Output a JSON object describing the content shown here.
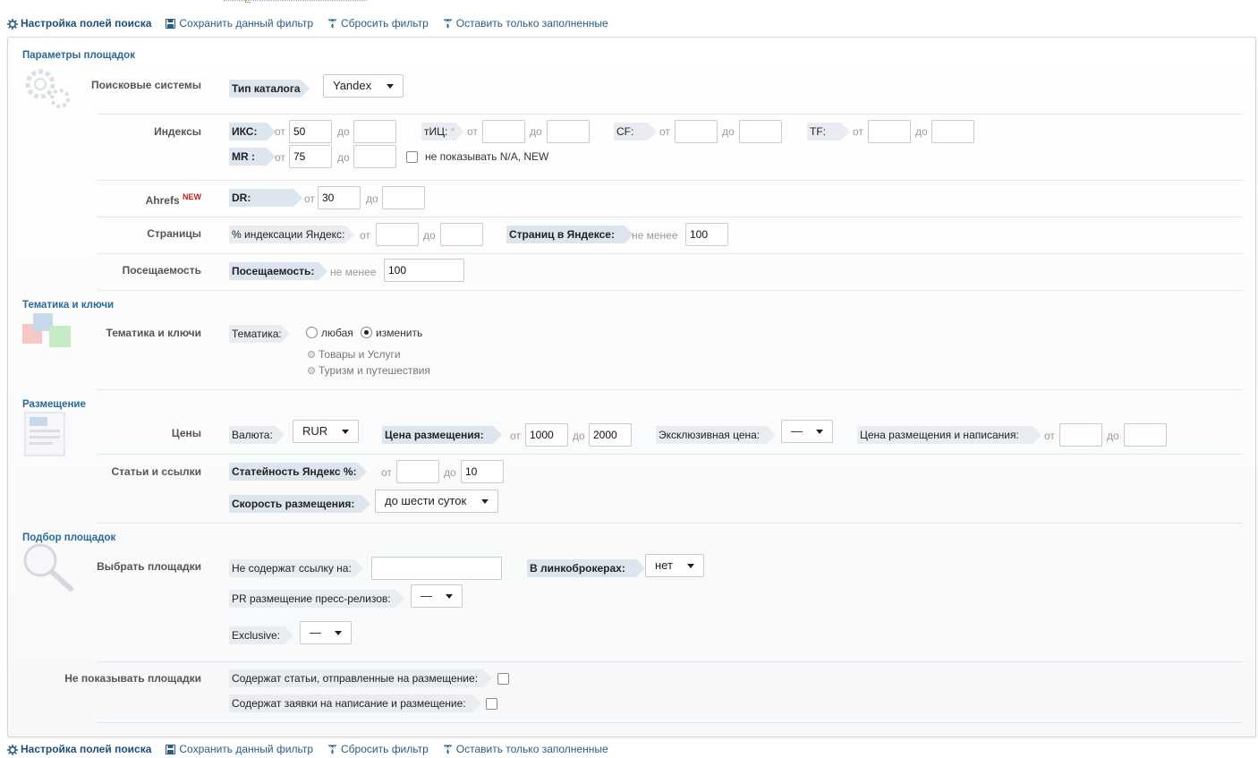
{
  "toolbar": {
    "settings": "Настройка полей поиска",
    "save": "Сохранить данный фильтр",
    "reset": "Сбросить фильтр",
    "only_filled": "Оставить только заполненные"
  },
  "sections": {
    "params": "Параметры площадок",
    "topics": "Тематика и ключи",
    "placement": "Размещение",
    "selection": "Подбор площадок"
  },
  "rows": {
    "search_engines": "Поисковые системы",
    "indexes": "Индексы",
    "ahrefs": "Ahrefs",
    "ahrefs_badge": "NEW",
    "pages": "Страницы",
    "traffic": "Посещаемость",
    "topics": "Тематика и ключи",
    "prices": "Цены",
    "articles": "Статьи и ссылки",
    "choose": "Выбрать площадки",
    "hide": "Не показывать площадки"
  },
  "words": {
    "from": "от",
    "to": "до",
    "min": "не менее"
  },
  "search": {
    "catalog_label": "Тип каталога:",
    "catalog_value": "Yandex"
  },
  "indexes": {
    "iks_label": "ИКС:",
    "iks_from": "50",
    "iks_to": "",
    "tic_label": "тИЦ:",
    "tic_star": "*",
    "tic_from": "",
    "tic_to": "",
    "cf_label": "CF:",
    "cf_from": "",
    "cf_to": "",
    "tf_label": "TF:",
    "tf_from": "",
    "tf_to": "",
    "mr_label": "MR :",
    "mr_from": "75",
    "mr_to": "",
    "hide_na_label": "не показывать N/A, NEW"
  },
  "ahrefs": {
    "dr_label": "DR:",
    "dr_from": "30",
    "dr_to": ""
  },
  "pages": {
    "idx_label": "% индексации Яндекс:",
    "idx_from": "",
    "idx_to": "",
    "yandex_pages_label": "Страниц в Яндексе:",
    "yandex_pages_min": "100"
  },
  "traffic": {
    "label": "Посещаемость:",
    "min": "100"
  },
  "topics": {
    "label": "Тематика:",
    "opt_any": "любая",
    "opt_change": "изменить",
    "selected": [
      "Товары и Услуги",
      "Туризм и путешествия"
    ]
  },
  "prices": {
    "currency_label": "Валюта:",
    "currency_value": "RUR",
    "price_label": "Цена размещения:",
    "price_from": "1000",
    "price_to": "2000",
    "exclusive_label": "Эксклюзивная цена:",
    "exclusive_value": "—",
    "write_price_label": "Цена размещения и написания:",
    "write_from": "",
    "write_to": ""
  },
  "articles": {
    "stat_label": "Статейность Яндекс %:",
    "stat_from": "",
    "stat_to": "10",
    "speed_label": "Скорость размещения:",
    "speed_value": "до шести суток"
  },
  "choose": {
    "nolink_label": "Не содержат ссылку на:",
    "nolink_value": "",
    "brokers_label": "В линкоброкерах:",
    "brokers_value": "нет",
    "pr_label": "PR размещение пресс-релизов:",
    "pr_value": "—",
    "exclusive_label": "Exclusive:",
    "exclusive_value": "—"
  },
  "hide": {
    "sent_label": "Содержат статьи, отправленные на размещение:",
    "orders_label": "Содержат заявки на написание и размещение:"
  }
}
